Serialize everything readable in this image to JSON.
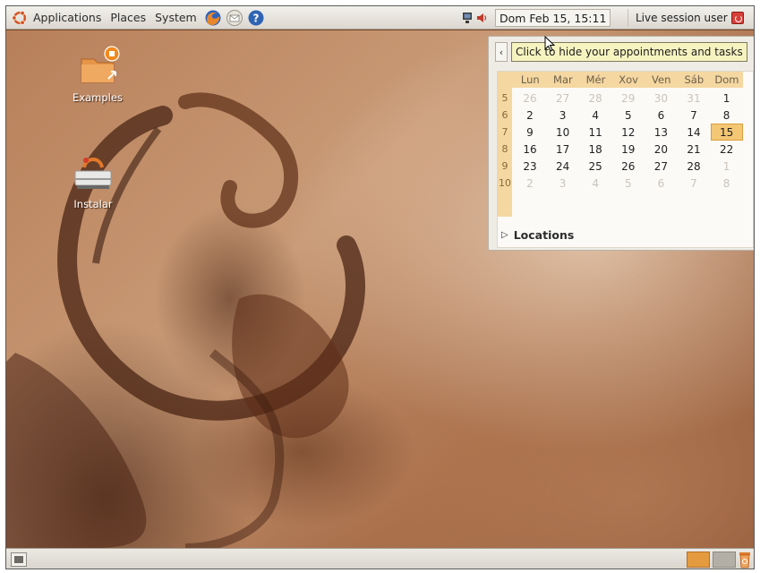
{
  "top_panel": {
    "applications": "Applications",
    "places": "Places",
    "system": "System",
    "clock": "Dom Feb 15, 15:11",
    "session_user": "Live session user"
  },
  "desktop": {
    "icons": [
      {
        "label": "Examples"
      },
      {
        "label": "Instalar"
      }
    ]
  },
  "calendar": {
    "tooltip": "Click to hide your appointments and tasks",
    "day_headers": [
      "Lun",
      "Mar",
      "Mér",
      "Xov",
      "Ven",
      "Sáb",
      "Dom"
    ],
    "week_numbers": [
      "5",
      "6",
      "7",
      "8",
      "9",
      "10"
    ],
    "weeks": [
      [
        "26",
        "27",
        "28",
        "29",
        "30",
        "31",
        "1"
      ],
      [
        "2",
        "3",
        "4",
        "5",
        "6",
        "7",
        "8"
      ],
      [
        "9",
        "10",
        "11",
        "12",
        "13",
        "14",
        "15"
      ],
      [
        "16",
        "17",
        "18",
        "19",
        "20",
        "21",
        "22"
      ],
      [
        "23",
        "24",
        "25",
        "26",
        "27",
        "28",
        "1"
      ],
      [
        "2",
        "3",
        "4",
        "5",
        "6",
        "7",
        "8"
      ]
    ],
    "today": "15",
    "locations_label": "Locations"
  },
  "colors": {
    "accent": "#e49a3e",
    "calendar_header": "#f4d7a1",
    "today_highlight": "#f4c774"
  }
}
